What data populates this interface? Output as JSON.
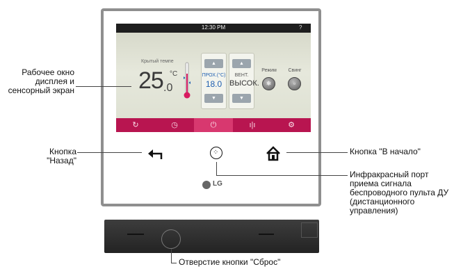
{
  "screen": {
    "time": "12:30 PM",
    "help": "?",
    "temp_label": "Крытый темпе",
    "temp_whole": "25",
    "temp_decimal": ".0",
    "temp_unit": "°C",
    "cool_label": "ПРОХ.(°C)",
    "cool_value": "18.0",
    "fan_label": "ВЕНТ.",
    "fan_value": "ВЫСОК.",
    "mode_label": "Режим",
    "swing_label": "Свинг",
    "tabs": [
      {
        "name": "schedule-off",
        "glyph": "↻"
      },
      {
        "name": "timer",
        "glyph": "◷"
      },
      {
        "name": "power",
        "glyph": "⏻"
      },
      {
        "name": "energy",
        "glyph": "ı|ı"
      },
      {
        "name": "settings",
        "glyph": "⚙"
      }
    ]
  },
  "callouts": {
    "display": "Рабочее окно дисплея и сенсорный экран",
    "back": "Кнопка \"Назад\"",
    "home": "Кнопка \"В начало\"",
    "ir": "Инфракрасный порт приема сигнала беспроводного пульта ДУ (дистанционного управления)",
    "reset": "Отверстие кнопки \"Сброс\""
  },
  "brand": "LG",
  "colors": {
    "accent": "#b81550",
    "accent_active": "#d8386f",
    "value_blue": "#1f5fb0"
  }
}
